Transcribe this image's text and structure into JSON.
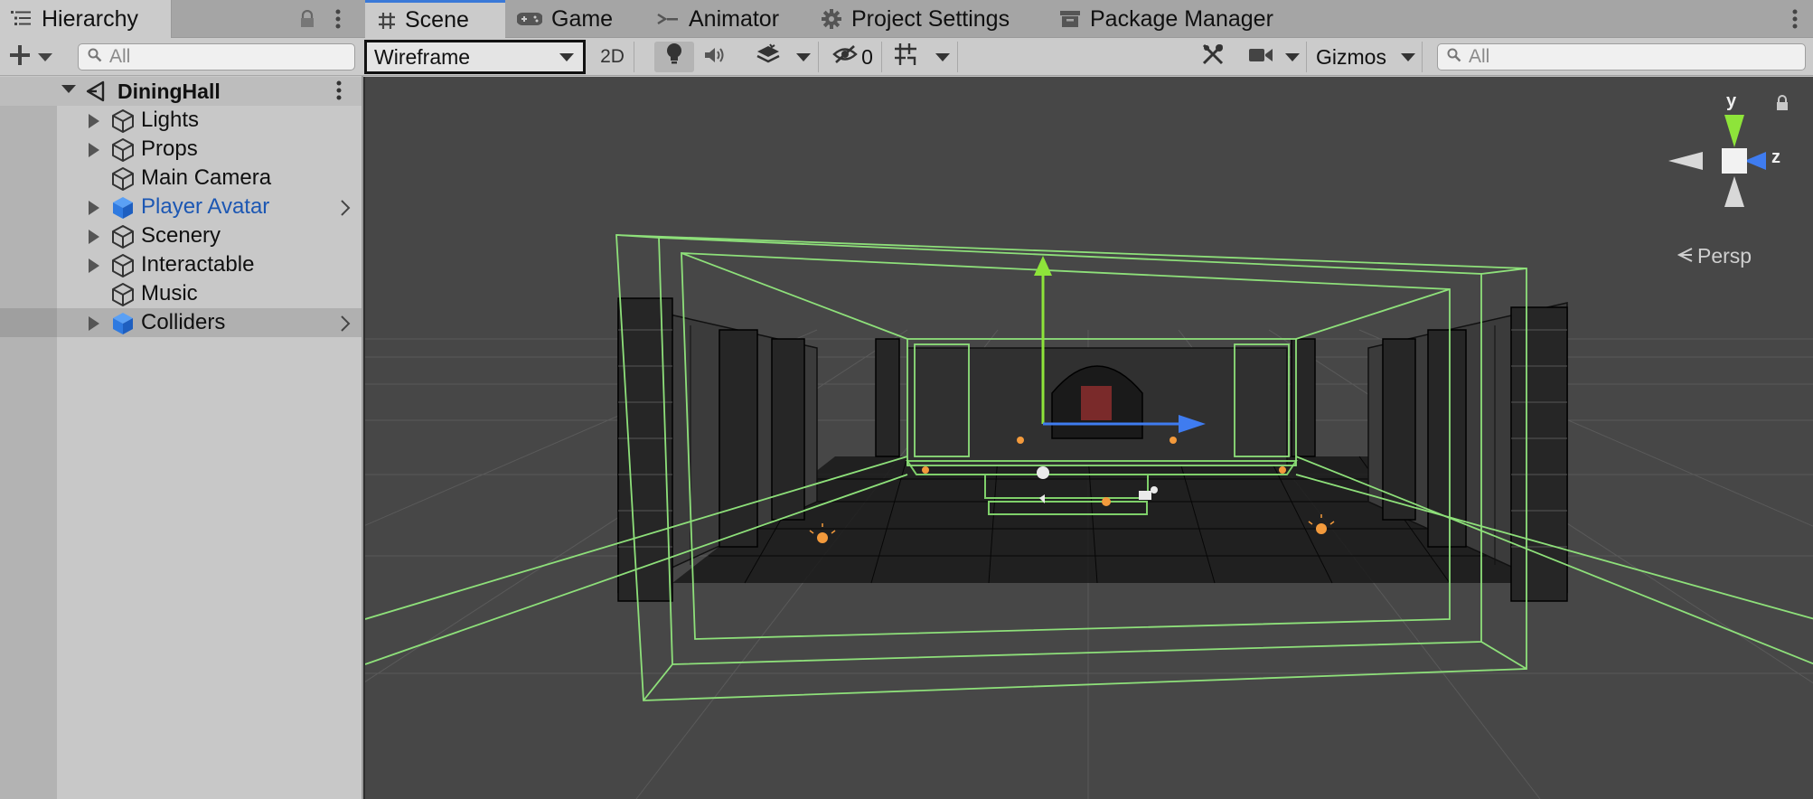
{
  "hierarchy": {
    "tab_label": "Hierarchy",
    "search_placeholder": "All",
    "scene_name": "DiningHall",
    "items": [
      {
        "label": "Lights",
        "foldout": true,
        "prefab": false
      },
      {
        "label": "Props",
        "foldout": true,
        "prefab": false
      },
      {
        "label": "Main Camera",
        "foldout": false,
        "prefab": false
      },
      {
        "label": "Player Avatar",
        "foldout": true,
        "prefab": true
      },
      {
        "label": "Scenery",
        "foldout": true,
        "prefab": false
      },
      {
        "label": "Interactable",
        "foldout": true,
        "prefab": false
      },
      {
        "label": "Music",
        "foldout": false,
        "prefab": false
      },
      {
        "label": "Colliders",
        "foldout": true,
        "prefab": true
      }
    ]
  },
  "tabs": {
    "scene": "Scene",
    "game": "Game",
    "animator": "Animator",
    "project_settings": "Project Settings",
    "package_manager": "Package Manager"
  },
  "scene_toolbar": {
    "draw_mode": "Wireframe",
    "mode_2d": "2D",
    "hidden_count": "0",
    "gizmos_label": "Gizmos",
    "search_placeholder": "All"
  },
  "viewport": {
    "axis_y": "y",
    "axis_z": "z",
    "projection": "Persp"
  },
  "colors": {
    "accent": "#3a79d8",
    "prefab_text": "#1c57b3",
    "viewport_bg": "#474747",
    "collider_green": "#8ee07a",
    "gizmo_y": "#8ee43a",
    "gizmo_z": "#3f7cf0"
  }
}
